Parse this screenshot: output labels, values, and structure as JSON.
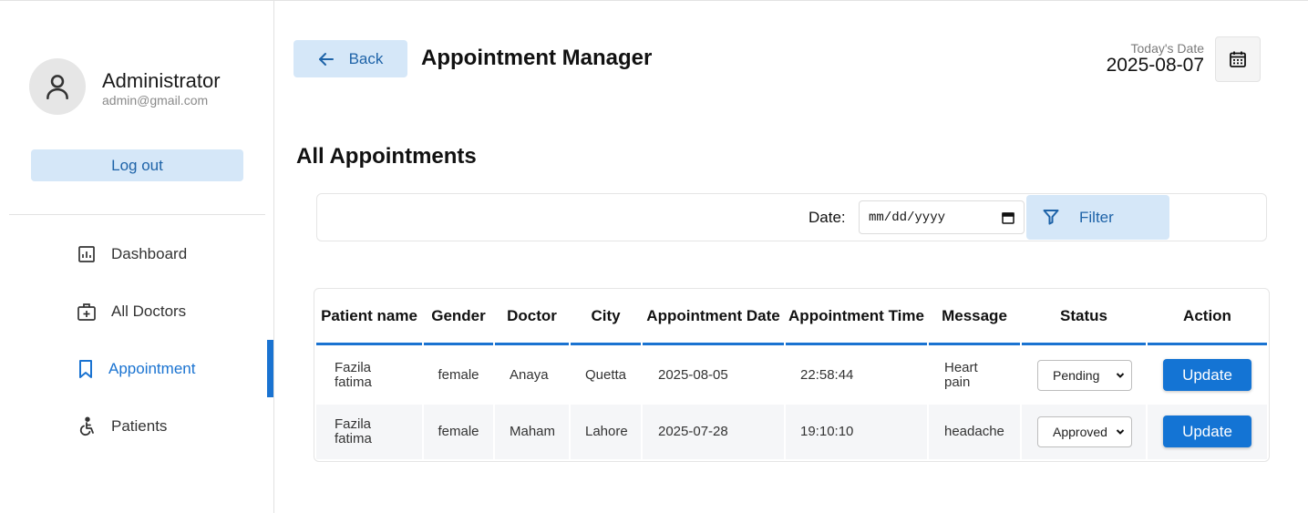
{
  "user": {
    "name": "Administrator",
    "email": "admin@gmail.com"
  },
  "sidebar": {
    "logout_label": "Log out",
    "items": [
      {
        "label": "Dashboard",
        "icon": "chart-icon"
      },
      {
        "label": "All Doctors",
        "icon": "medical-bag-icon"
      },
      {
        "label": "Appointment",
        "icon": "bookmark-icon",
        "active": true
      },
      {
        "label": "Patients",
        "icon": "accessible-icon"
      }
    ]
  },
  "header": {
    "back_label": "Back",
    "title": "Appointment Manager",
    "today_label": "Today's Date",
    "today_value": "2025-08-07"
  },
  "section": {
    "title": "All Appointments"
  },
  "filter": {
    "date_label": "Date:",
    "date_placeholder": "mm/dd/yyyy",
    "button_label": "Filter"
  },
  "table": {
    "headers": [
      "Patient name",
      "Gender",
      "Doctor",
      "City",
      "Appointment Date",
      "Appointment Time",
      "Message",
      "Status",
      "Action"
    ],
    "rows": [
      {
        "patient": "Fazila fatima",
        "gender": "female",
        "doctor": "Anaya",
        "city": "Quetta",
        "date": "2025-08-05",
        "time": "22:58:44",
        "message": "Heart pain",
        "status": "Pending",
        "action": "Update"
      },
      {
        "patient": "Fazila fatima",
        "gender": "female",
        "doctor": "Maham",
        "city": "Lahore",
        "date": "2025-07-28",
        "time": "19:10:10",
        "message": "headache",
        "status": "Approved",
        "action": "Update"
      }
    ]
  },
  "colors": {
    "accent": "#1a73d1",
    "light_button": "#d5e7f8",
    "primary_button": "#1474d4",
    "alt_row": "#f5f6f8"
  }
}
